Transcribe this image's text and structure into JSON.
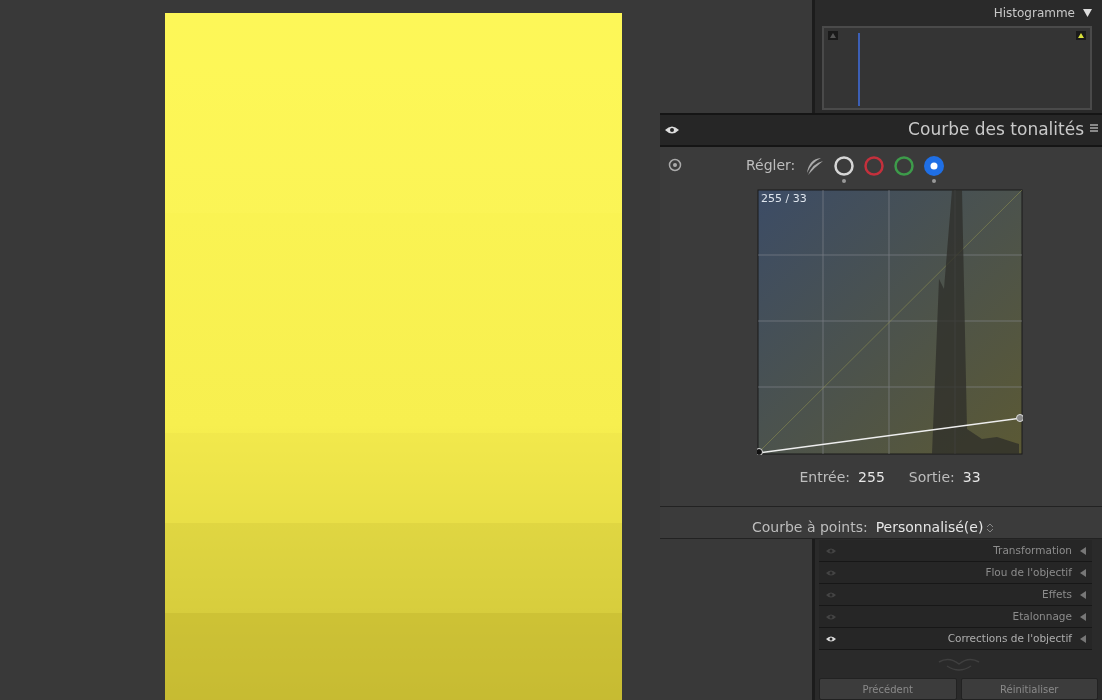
{
  "histogram": {
    "title": "Histogramme"
  },
  "tone_curve": {
    "title": "Courbe des tonalités",
    "adjust_label": "Régler:",
    "channels": [
      {
        "kind": "parametric",
        "selected": false,
        "edited": false
      },
      {
        "kind": "point",
        "color": "#d6d6d6",
        "selected": false,
        "edited": true
      },
      {
        "kind": "point",
        "color": "#c4303c",
        "selected": false,
        "edited": false
      },
      {
        "kind": "point",
        "color": "#3d9b4a",
        "selected": false,
        "edited": false
      },
      {
        "kind": "point",
        "color": "#1f6fe5",
        "selected": true,
        "edited": true
      }
    ],
    "readout": "255 / 33",
    "input_label": "Entrée:",
    "input_value": "255",
    "output_label": "Sortie:",
    "output_value": "33",
    "point_curve_label": "Courbe à points:",
    "point_curve_value": "Personnalisé(e)"
  },
  "panels": [
    {
      "title": "Transformation",
      "visible": false
    },
    {
      "title": "Flou de l'objectif",
      "visible": false
    },
    {
      "title": "Effets",
      "visible": false
    },
    {
      "title": "Etalonnage",
      "visible": false
    },
    {
      "title": "Corrections de l'objectif",
      "visible": true
    }
  ],
  "buttons": [
    "Précédent",
    "Réinitialiser"
  ]
}
